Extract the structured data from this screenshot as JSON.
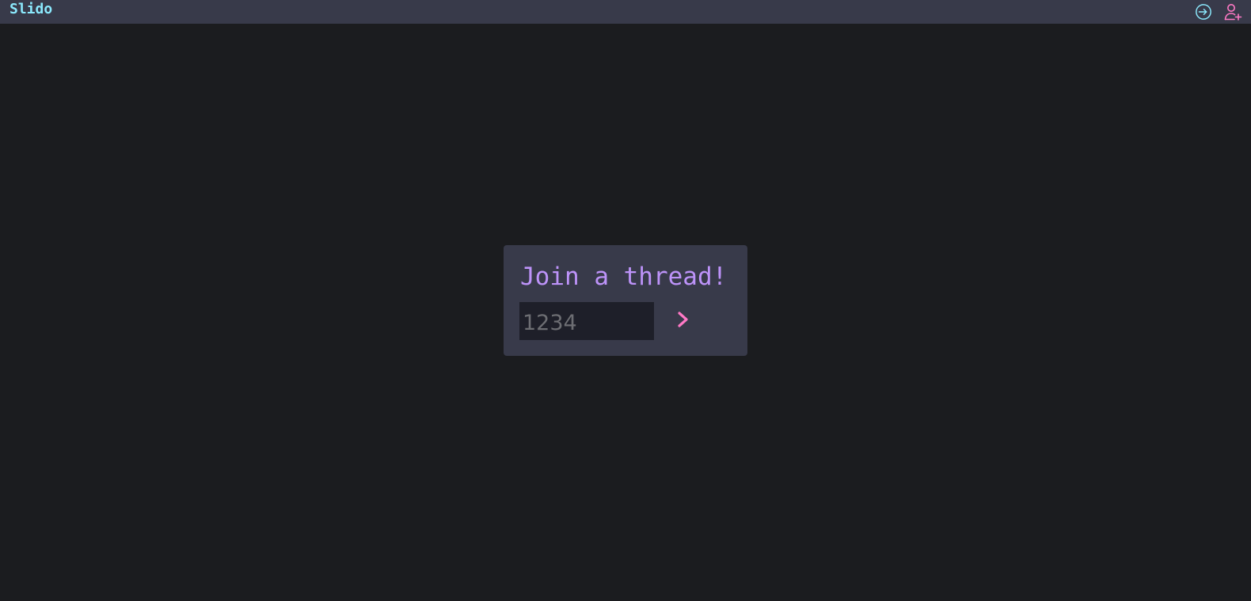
{
  "header": {
    "brand": "Slido",
    "login_icon": "login-icon",
    "signup_icon": "user-add-icon"
  },
  "join": {
    "title": "Join a thread!",
    "code_placeholder": "1234",
    "code_value": "",
    "submit_icon": "chevron-right-icon"
  },
  "colors": {
    "background": "#1b1c1f",
    "header": "#383a4a",
    "card": "#383a4a",
    "input": "#1e1f29",
    "brand": "#8be9fd",
    "title": "#bd93f9",
    "accent_pink": "#ff79c6",
    "login_icon": "#8be9fd"
  }
}
